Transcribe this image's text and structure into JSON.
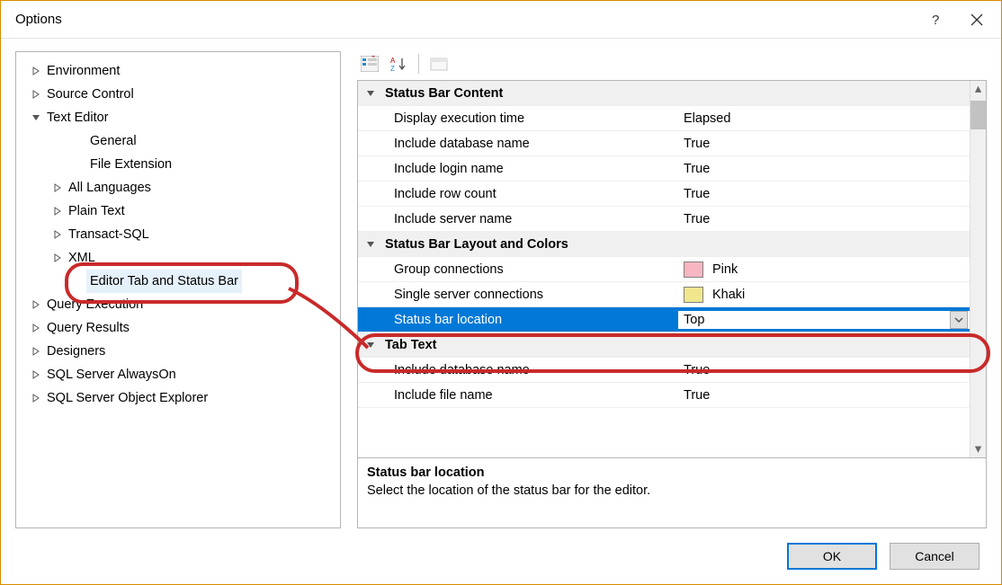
{
  "window": {
    "title": "Options",
    "help_tooltip": "?",
    "close_tooltip": "Close"
  },
  "tree": {
    "items": [
      {
        "indent": 0,
        "expander": "right",
        "label": "Environment"
      },
      {
        "indent": 0,
        "expander": "right",
        "label": "Source Control"
      },
      {
        "indent": 0,
        "expander": "down",
        "label": "Text Editor"
      },
      {
        "indent": 2,
        "expander": "",
        "label": "General"
      },
      {
        "indent": 2,
        "expander": "",
        "label": "File Extension"
      },
      {
        "indent": 1,
        "expander": "right",
        "label": "All Languages"
      },
      {
        "indent": 1,
        "expander": "right",
        "label": "Plain Text"
      },
      {
        "indent": 1,
        "expander": "right",
        "label": "Transact-SQL"
      },
      {
        "indent": 1,
        "expander": "right",
        "label": "XML"
      },
      {
        "indent": 2,
        "expander": "",
        "label": "Editor Tab and Status Bar",
        "selected": true
      },
      {
        "indent": 0,
        "expander": "right",
        "label": "Query Execution"
      },
      {
        "indent": 0,
        "expander": "right",
        "label": "Query Results"
      },
      {
        "indent": 0,
        "expander": "right",
        "label": "Designers"
      },
      {
        "indent": 0,
        "expander": "right",
        "label": "SQL Server AlwaysOn"
      },
      {
        "indent": 0,
        "expander": "right",
        "label": "SQL Server Object Explorer"
      }
    ]
  },
  "toolbar": {
    "categorized": "Categorized",
    "alpha": "Alphabetical",
    "pages": "Property Pages"
  },
  "grid": {
    "rows": [
      {
        "type": "cat",
        "exp": "down",
        "key": "Status Bar Content"
      },
      {
        "type": "prop",
        "key": "Display execution time",
        "val": "Elapsed"
      },
      {
        "type": "prop",
        "key": "Include database name",
        "val": "True"
      },
      {
        "type": "prop",
        "key": "Include login name",
        "val": "True"
      },
      {
        "type": "prop",
        "key": "Include row count",
        "val": "True"
      },
      {
        "type": "prop",
        "key": "Include server name",
        "val": "True"
      },
      {
        "type": "cat",
        "exp": "down",
        "key": "Status Bar Layout and Colors"
      },
      {
        "type": "prop",
        "key": "Group connections",
        "swatch": "#f7b6c2",
        "val": "Pink"
      },
      {
        "type": "prop",
        "key": "Single server connections",
        "swatch": "#f0e68c",
        "val": "Khaki"
      },
      {
        "type": "prop",
        "key": "Status bar location",
        "val": "Top",
        "selected": true,
        "dropdown": true
      },
      {
        "type": "cat",
        "exp": "down",
        "key": "Tab Text"
      },
      {
        "type": "prop",
        "key": "Include database name",
        "val": "True"
      },
      {
        "type": "prop",
        "key": "Include file name",
        "val": "True"
      }
    ]
  },
  "description": {
    "title": "Status bar location",
    "text": "Select the location of the status bar for the editor."
  },
  "buttons": {
    "ok": "OK",
    "cancel": "Cancel"
  },
  "colors": {
    "selection": "#0078d7"
  }
}
